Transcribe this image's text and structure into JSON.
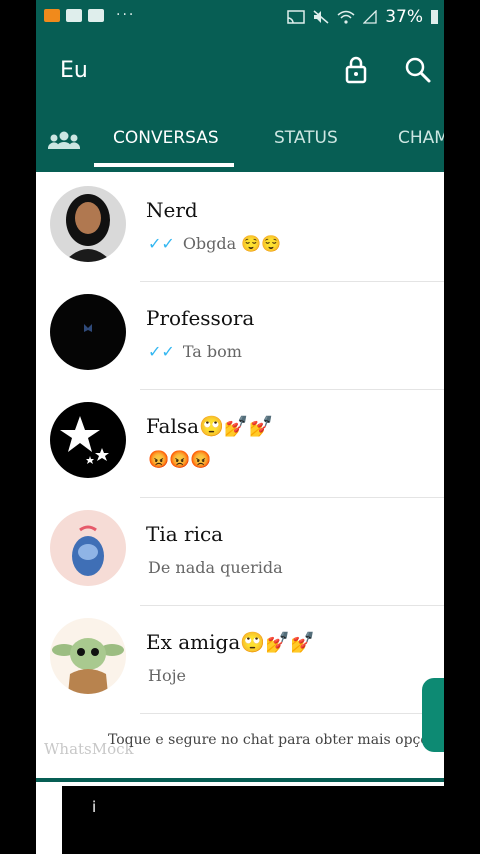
{
  "statusbar": {
    "battery": "37%",
    "dots": "···",
    "icons": [
      "video-app-icon",
      "gallery-icon",
      "youtube-icon",
      "cast-icon",
      "mute-icon",
      "wifi-icon",
      "signal-icon"
    ]
  },
  "toolbar": {
    "title": "Eu"
  },
  "tabs": {
    "items": [
      {
        "label": "CONVERSAS",
        "active": true
      },
      {
        "label": "STATUS",
        "active": false
      },
      {
        "label": "CHAM",
        "active": false
      }
    ]
  },
  "chats": [
    {
      "name": "Nerd",
      "preview": "Obgda 😌😌",
      "ticks": "✓✓"
    },
    {
      "name": "Professora",
      "preview": "Ta bom",
      "ticks": "✓✓"
    },
    {
      "name": "Falsa🙄💅💅",
      "preview": "😡😡😡",
      "ticks": ""
    },
    {
      "name": "Tia rica",
      "preview": "De nada querida",
      "ticks": ""
    },
    {
      "name": "Ex amiga🙄💅💅",
      "preview": "Hoje",
      "ticks": ""
    }
  ],
  "hint": "Toque e segure no chat para obter mais opçõ",
  "watermark": "WhatsMock",
  "bottom_char": "i",
  "colors": {
    "primary": "#075e54",
    "accent": "#34b7f1",
    "fab": "#0d8a73"
  }
}
